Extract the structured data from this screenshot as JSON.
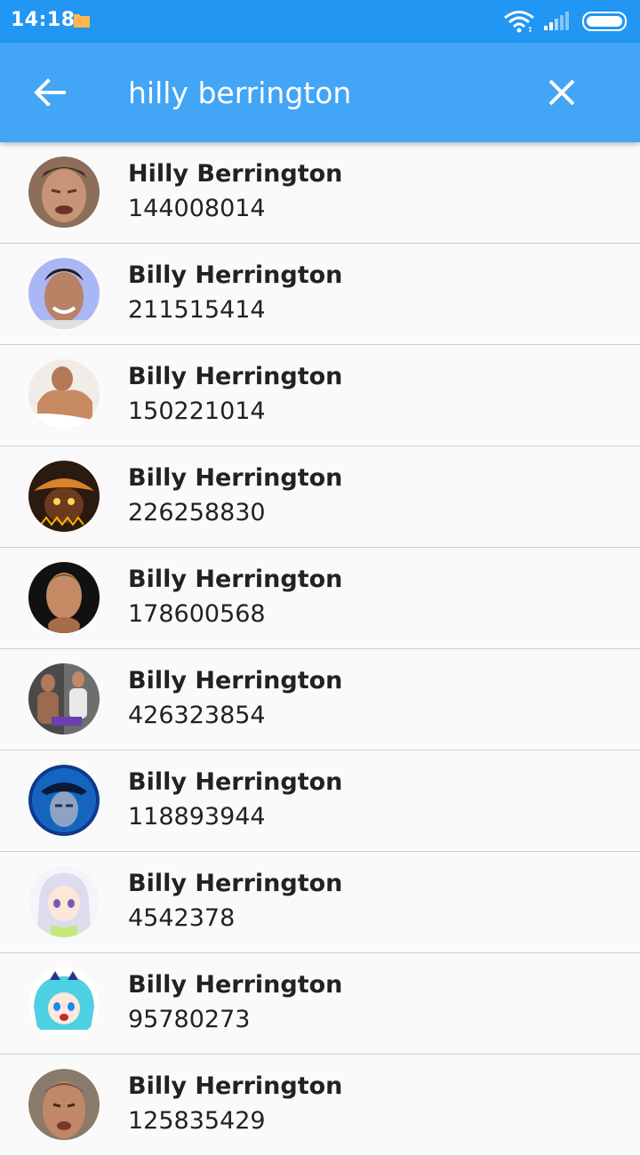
{
  "status_bar": {
    "time": "14:18",
    "icons": [
      "folder-icon",
      "wifi-icon",
      "signal-icon",
      "battery-icon"
    ]
  },
  "app_bar": {
    "back_icon": "arrow-left-icon",
    "search_value": "hilly berrington",
    "clear_icon": "close-icon",
    "color": "#42a5f5",
    "status_color": "#2196f3"
  },
  "results": [
    {
      "name": "Hilly Berrington",
      "id": "144008014",
      "avatar": "avatar-photo-face"
    },
    {
      "name": "Billy Herrington",
      "id": "211515414",
      "avatar": "avatar-photo-smile"
    },
    {
      "name": "Billy Herrington",
      "id": "150221014",
      "avatar": "avatar-photo-muscle"
    },
    {
      "name": "Billy Herrington",
      "id": "226258830",
      "avatar": "avatar-character-helmet"
    },
    {
      "name": "Billy Herrington",
      "id": "178600568",
      "avatar": "avatar-photo-portrait"
    },
    {
      "name": "Billy Herrington",
      "id": "426323854",
      "avatar": "avatar-photo-two-men"
    },
    {
      "name": "Billy Herrington",
      "id": "118893944",
      "avatar": "avatar-photo-blue-hat"
    },
    {
      "name": "Billy Herrington",
      "id": "4542378",
      "avatar": "avatar-anime-girl-silver"
    },
    {
      "name": "Billy Herrington",
      "id": "95780273",
      "avatar": "avatar-anime-girl-cyan"
    },
    {
      "name": "Billy Herrington",
      "id": "125835429",
      "avatar": "avatar-photo-face-2"
    }
  ]
}
